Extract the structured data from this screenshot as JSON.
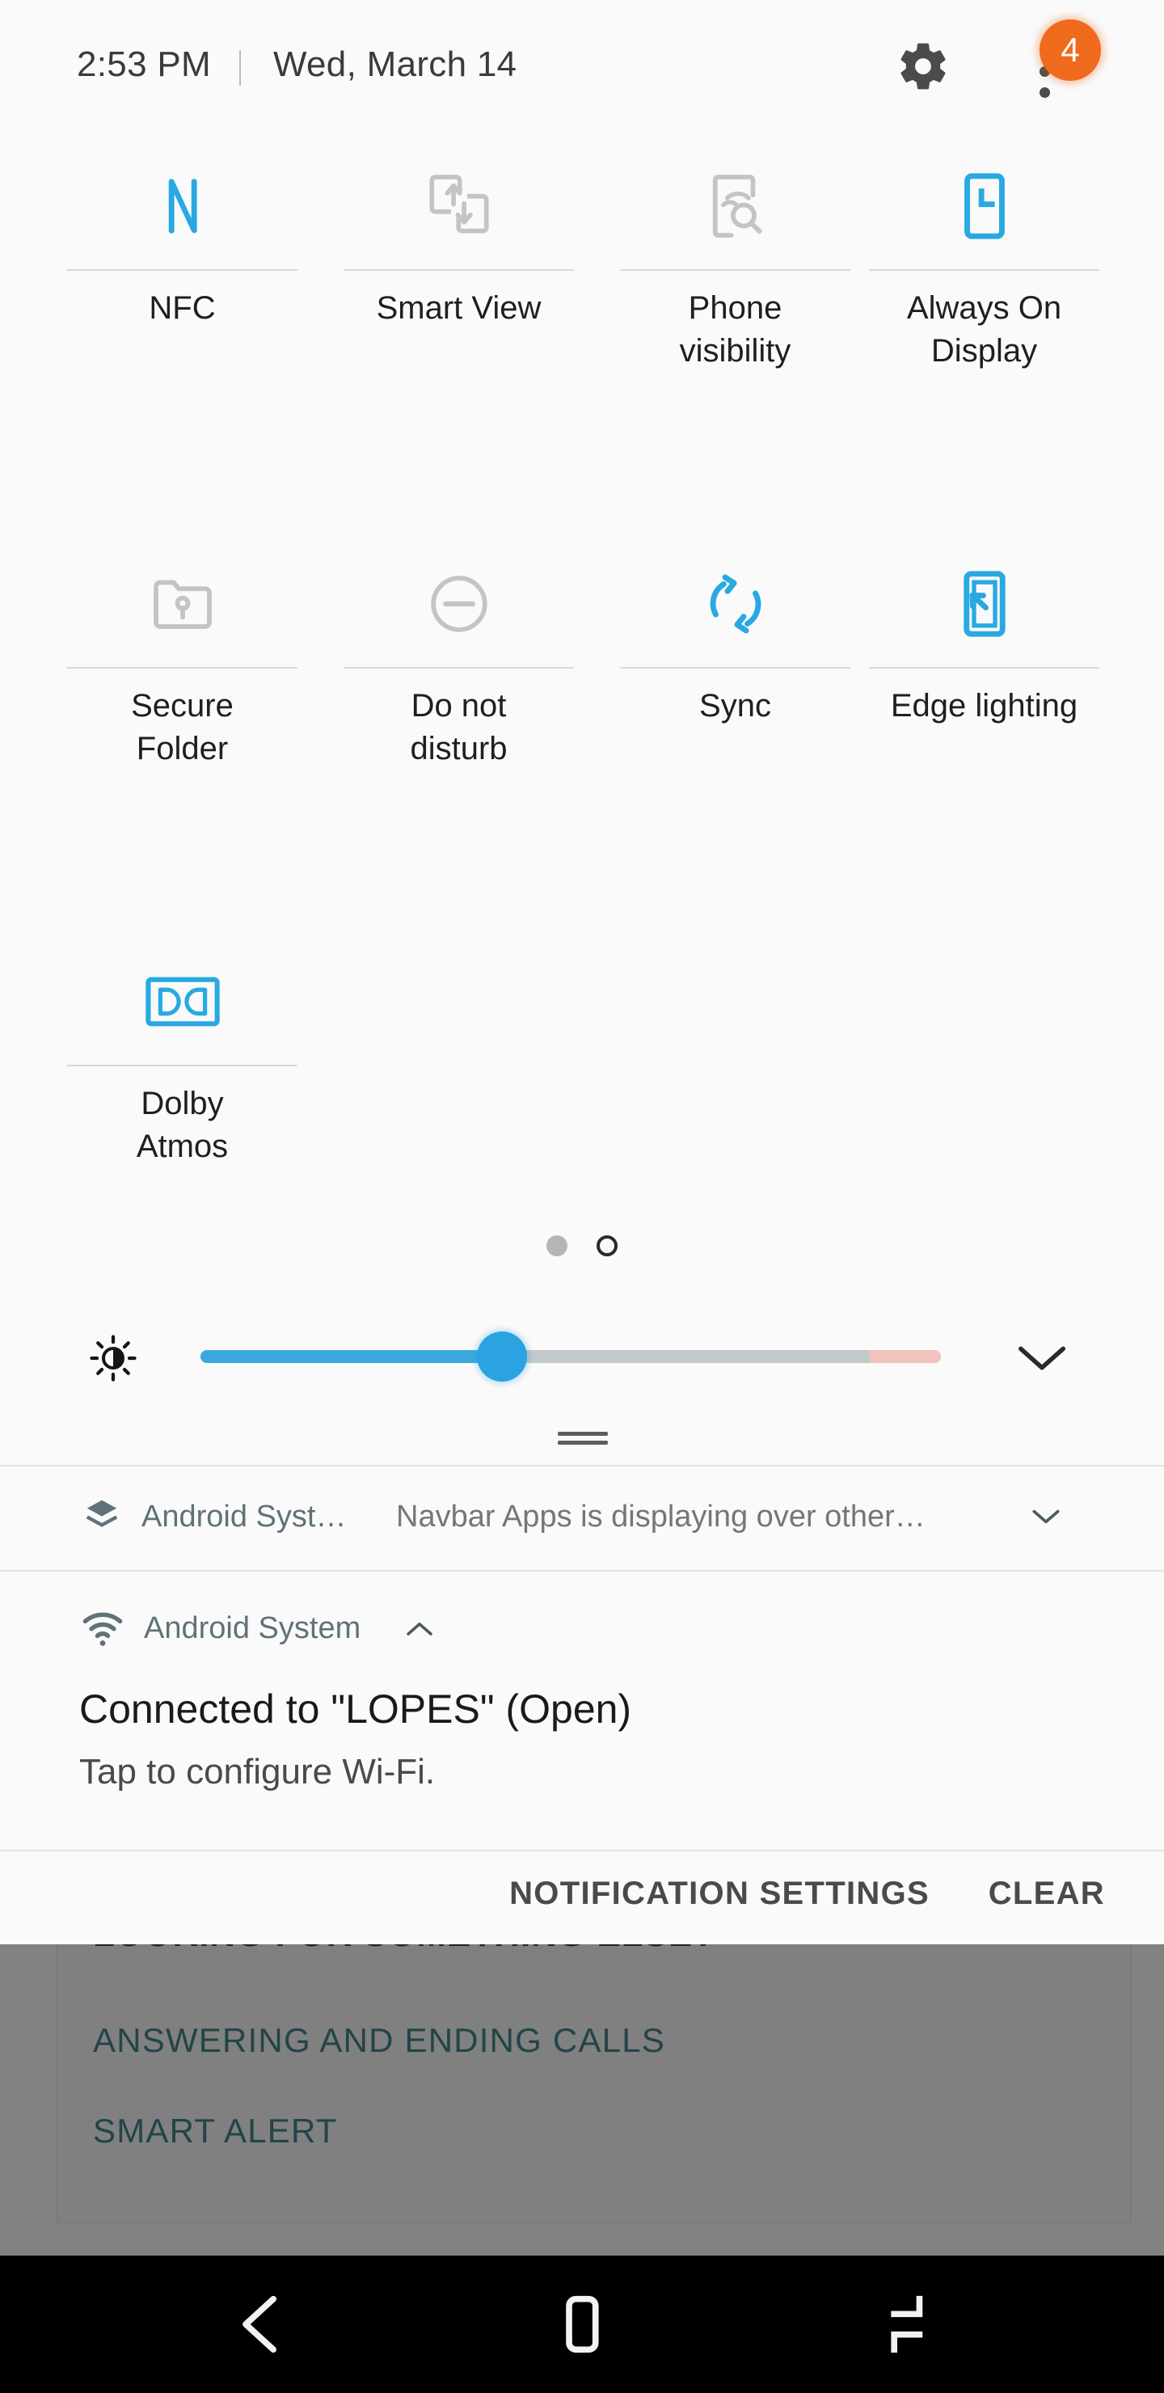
{
  "status_bar": {
    "time": "2:53 PM",
    "date": "Wed, March 14",
    "gear_icon": "gear-icon",
    "overflow_icon": "three-dot-menu-icon",
    "notification_badge_count": "4",
    "badge_color": "#f06a1e"
  },
  "quick_settings": {
    "accent_active_color": "#29a9e1",
    "inactive_color": "#c4c4c4",
    "tiles": [
      {
        "label": "NFC",
        "icon": "nfc-icon",
        "state": "on"
      },
      {
        "label": "Smart View",
        "icon": "smart-view-icon",
        "state": "off"
      },
      {
        "label": "Phone\nvisibility",
        "icon": "phone-visibility-icon",
        "state": "off"
      },
      {
        "label": "Always On\nDisplay",
        "icon": "always-on-display-icon",
        "state": "on"
      },
      {
        "label": "Secure\nFolder",
        "icon": "secure-folder-icon",
        "state": "off"
      },
      {
        "label": "Do not\ndisturb",
        "icon": "do-not-disturb-icon",
        "state": "off"
      },
      {
        "label": "Sync",
        "icon": "sync-icon",
        "state": "on"
      },
      {
        "label": "Edge lighting",
        "icon": "edge-lighting-icon",
        "state": "on"
      },
      {
        "label": "Dolby\nAtmos",
        "icon": "dolby-atmos-icon",
        "state": "on"
      }
    ],
    "page_indicator": {
      "total_pages": 2,
      "current_page": 2
    },
    "brightness": {
      "icon": "brightness-sun-icon",
      "value_percent": 40,
      "warning_zone_start_percent": 90,
      "expand_icon": "chevron-down-icon",
      "fill_color": "#3ba7dd",
      "track_color": "#c3c8cb",
      "warning_color": "#f2c2bc"
    },
    "drag_handle": "panel-drag-handle"
  },
  "notifications": [
    {
      "icon": "layers-icon",
      "app_name": "Android Syst…",
      "summary": "Navbar Apps is displaying over other…",
      "expand_icon": "chevron-down-icon",
      "expanded": false
    },
    {
      "icon": "wifi-icon",
      "app_name": "Android System",
      "expand_icon": "chevron-up-icon",
      "expanded": true,
      "title": "Connected to \"LOPES\" (Open)",
      "body": "Tap to configure Wi-Fi."
    }
  ],
  "notification_actions": {
    "settings_label": "NOTIFICATION SETTINGS",
    "clear_label": "CLEAR"
  },
  "background_page": {
    "heading": "LOOKING FOR SOMETHING ELSE?",
    "links": [
      "ANSWERING AND ENDING CALLS",
      "SMART ALERT"
    ],
    "link_color": "#1d6b78"
  },
  "nav_bar": {
    "back": "back-icon",
    "home": "home-icon",
    "recents": "recents-icon"
  }
}
